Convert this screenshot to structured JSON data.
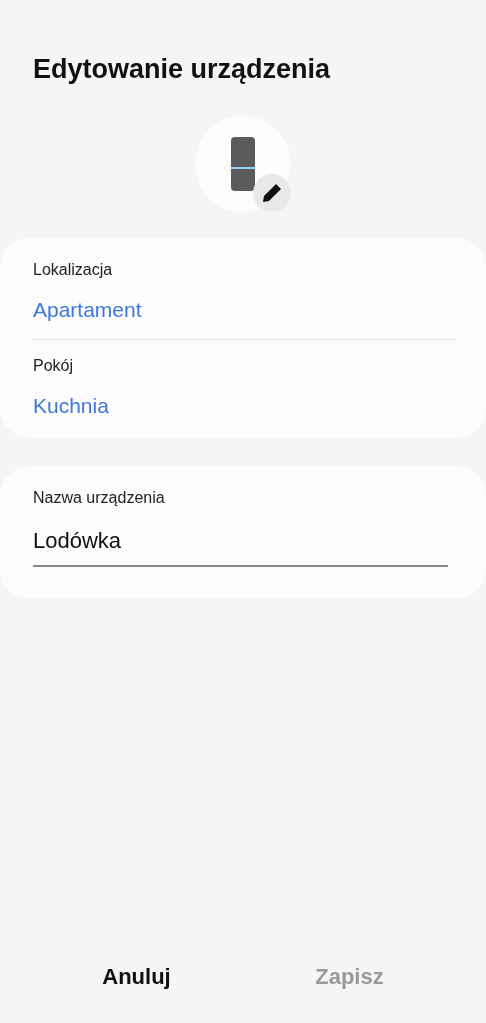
{
  "title": "Edytowanie urządzenia",
  "location_card": {
    "fields": [
      {
        "label": "Lokalizacja",
        "value": "Apartament"
      },
      {
        "label": "Pokój",
        "value": "Kuchnia"
      }
    ]
  },
  "name_card": {
    "label": "Nazwa urządzenia",
    "value": "Lodówka"
  },
  "buttons": [
    {
      "label": "Anuluj",
      "disabled": false
    },
    {
      "label": "Zapisz",
      "disabled": true
    }
  ]
}
